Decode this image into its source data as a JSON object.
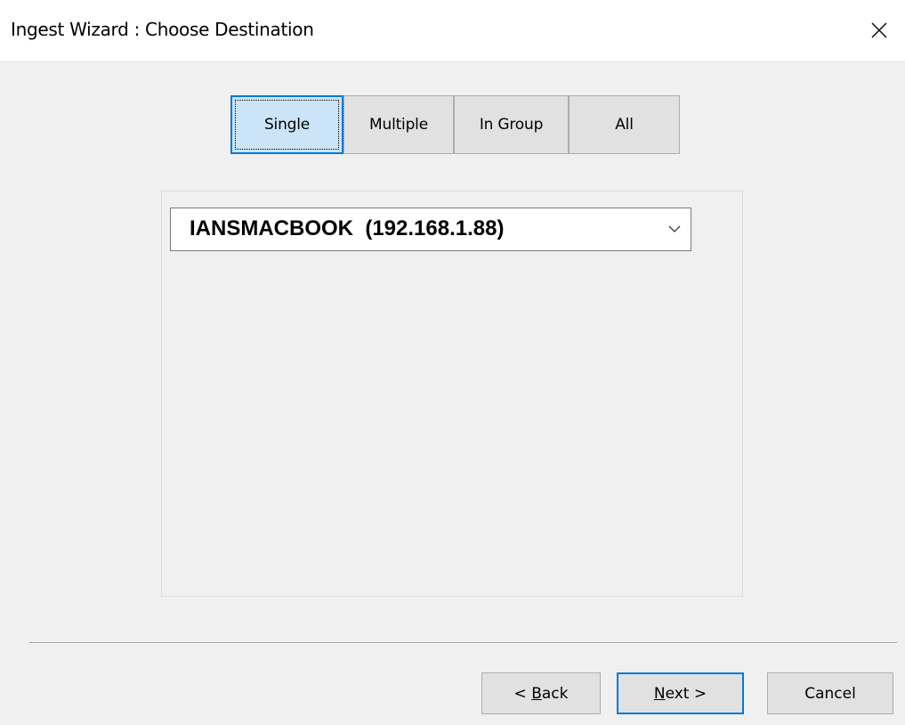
{
  "window": {
    "title": "Ingest Wizard : Choose Destination",
    "close_icon": "close-icon"
  },
  "mode_buttons": [
    {
      "label": "Single",
      "selected": true
    },
    {
      "label": "Multiple",
      "selected": false
    },
    {
      "label": "In Group",
      "selected": false
    },
    {
      "label": "All",
      "selected": false
    }
  ],
  "destination": {
    "selected_value": "IANSMACBOOK  (192.168.1.88)",
    "dropdown_icon": "chevron-down-icon"
  },
  "footer": {
    "back": {
      "prefix": "< ",
      "mnemonic": "B",
      "rest": "ack"
    },
    "next": {
      "mnemonic": "N",
      "rest": "ext >"
    },
    "cancel_label": "Cancel"
  },
  "colors": {
    "window_bg": "#f0f0f0",
    "titlebar_bg": "#ffffff",
    "selected_bg": "#cce4f7",
    "accent": "#0078d7",
    "button_bg": "#e1e1e1"
  }
}
